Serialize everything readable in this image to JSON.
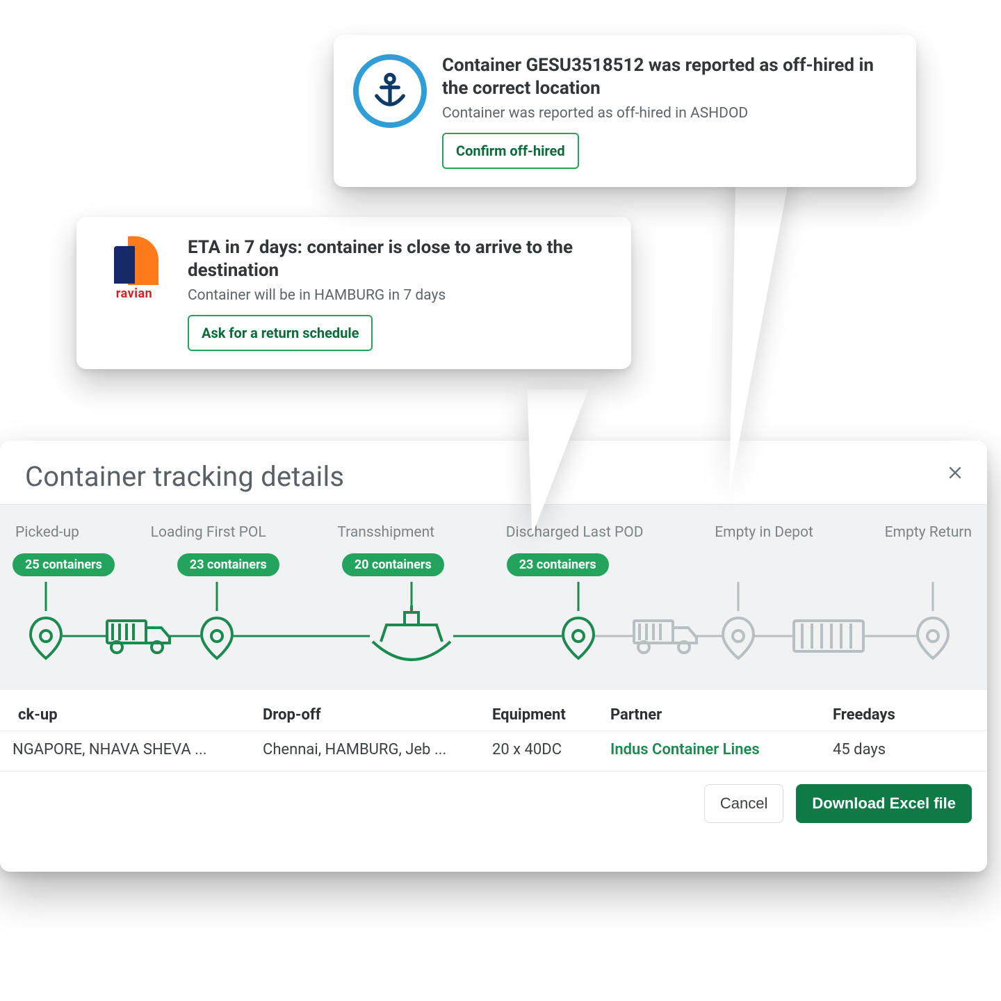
{
  "colors": {
    "green": "#1a8a4f",
    "pill": "#22a45d",
    "blue": "#2f9dd6",
    "navy": "#0e3a68"
  },
  "cards": {
    "top": {
      "title": "Container GESU3518512 was reported as off-hired in the correct location",
      "subtitle": "Container was reported as off-hired in ASHDOD",
      "button": "Confirm off-hired"
    },
    "mid": {
      "logo_text": "ravian",
      "title": "ETA in 7 days: container is close to arrive to the destination",
      "subtitle": "Container will be in HAMBURG in 7 days",
      "button": "Ask for a return schedule"
    }
  },
  "panel": {
    "title": "Container tracking details",
    "stages": [
      "Picked-up",
      "Loading First POL",
      "Transshipment",
      "Discharged Last POD",
      "Empty in Depot",
      "Empty Return"
    ],
    "pills": [
      "25 containers",
      "23 containers",
      "20 containers",
      "23 containers"
    ],
    "headers": {
      "pickup": "ck-up",
      "dropoff": "Drop-off",
      "equipment": "Equipment",
      "partner": "Partner",
      "freedays": "Freedays"
    },
    "row": {
      "pickup": "NGAPORE, NHAVA SHEVA ...",
      "dropoff": "Chennai, HAMBURG, Jeb ...",
      "equipment": "20 x 40DC",
      "partner": "Indus Container Lines",
      "freedays": "45 days"
    },
    "buttons": {
      "cancel": "Cancel",
      "download": "Download Excel file"
    }
  }
}
